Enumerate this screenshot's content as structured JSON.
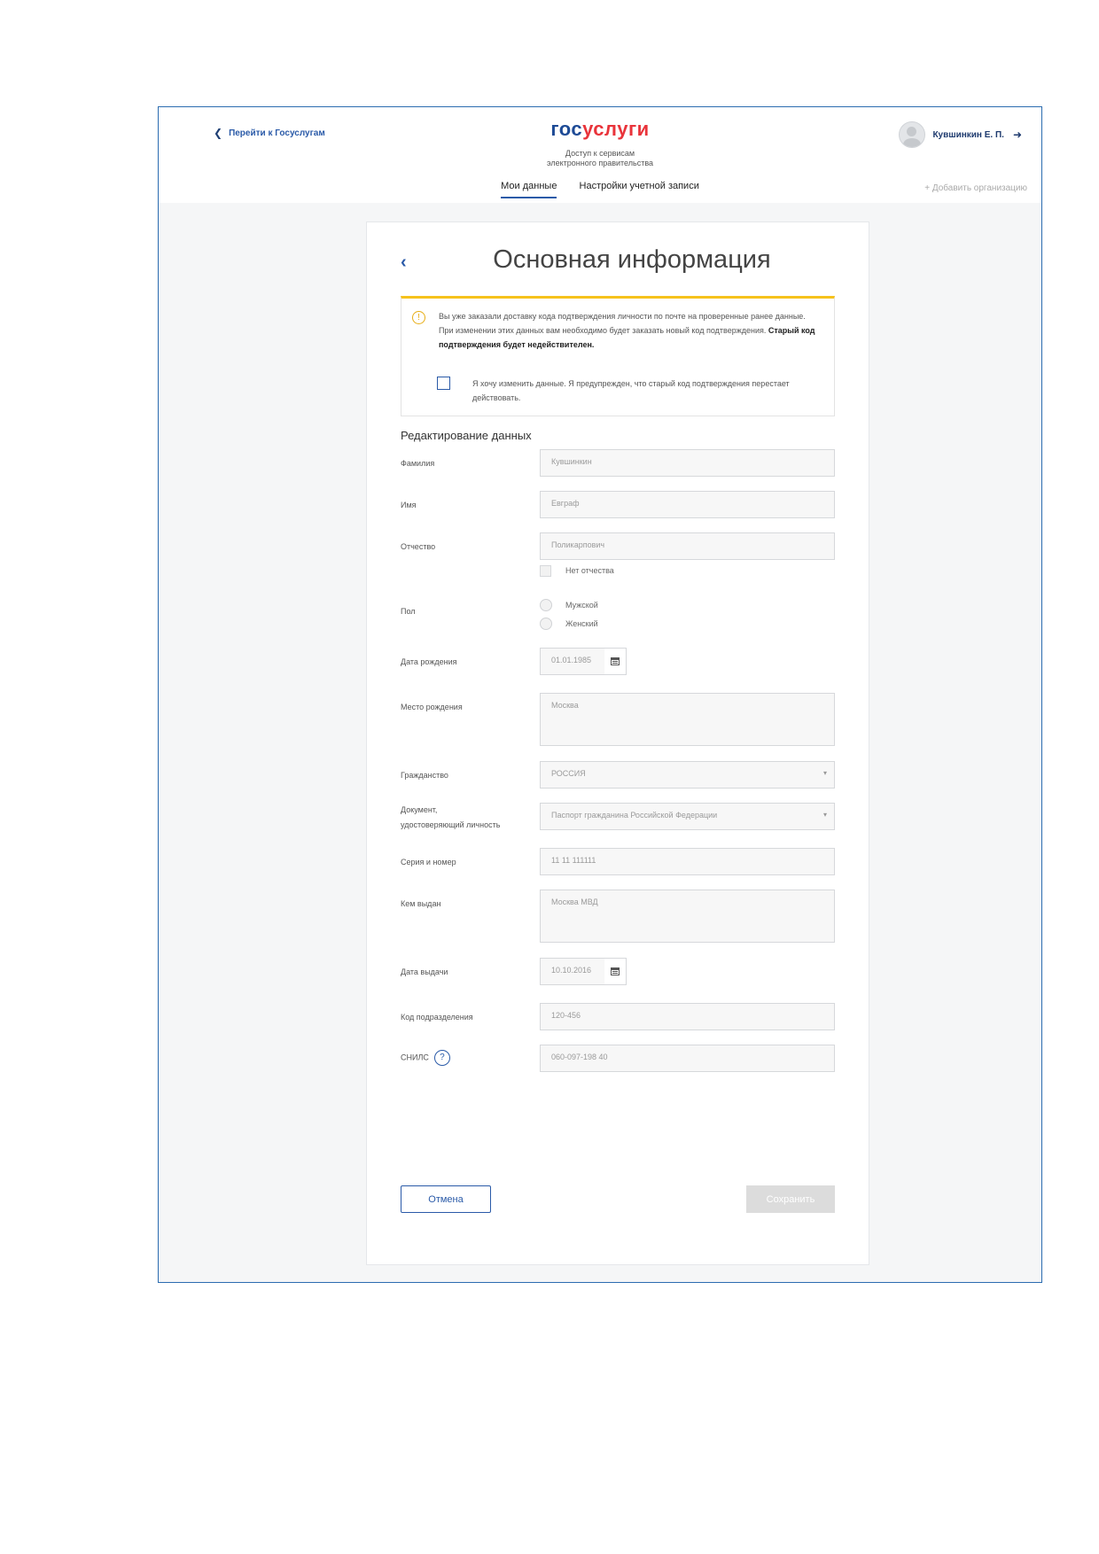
{
  "header": {
    "back_link": "Перейти к Госуслугам",
    "logo_part1": "гос",
    "logo_part2": "услуги",
    "tagline_line1": "Доступ к сервисам",
    "tagline_line2": "электронного правительства",
    "user_name": "Кувшинкин Е. П.",
    "tabs": [
      {
        "label": "Мои данные",
        "active": true
      },
      {
        "label": "Настройки учетной записи",
        "active": false
      }
    ],
    "add_org": "+ Добавить организацию"
  },
  "page": {
    "title": "Основная информация",
    "notice": {
      "text": "Вы уже заказали доставку кода подтверждения личности по почте на проверенные ранее данные. При изменении этих данных вам необходимо будет заказать новый код подтверждения.",
      "bold": "Старый код подтверждения будет недействителен.",
      "agree_label": "Я хочу изменить данные. Я предупрежден, что старый код подтверждения перестает действовать.",
      "agree_checked": false
    },
    "section_title": "Редактирование данных"
  },
  "form": {
    "surname": {
      "label": "Фамилия",
      "value": "Кувшинкин"
    },
    "name": {
      "label": "Имя",
      "value": "Евграф"
    },
    "patronymic": {
      "label": "Отчество",
      "value": "Поликарпович"
    },
    "no_patronymic_label": "Нет отчества",
    "gender": {
      "label": "Пол",
      "options": [
        "Мужской",
        "Женский"
      ]
    },
    "birth_date": {
      "label": "Дата рождения",
      "value": "01.01.1985"
    },
    "birth_place": {
      "label": "Место рождения",
      "value": "Москва"
    },
    "citizenship": {
      "label": "Гражданство",
      "value": "РОССИЯ"
    },
    "document": {
      "label_line1": "Документ,",
      "label_line2": "удостоверяющий личность",
      "value": "Паспорт гражданина Российской Федерации"
    },
    "series_number": {
      "label": "Серия и номер",
      "value": "11 11 111111"
    },
    "issued_by": {
      "label": "Кем выдан",
      "value": "Москва МВД"
    },
    "issue_date": {
      "label": "Дата выдачи",
      "value": "10.10.2016"
    },
    "division_code": {
      "label": "Код подразделения",
      "value": "120-456"
    },
    "snils": {
      "label": "СНИЛС",
      "help": "?",
      "value": "060-097-198 40"
    }
  },
  "buttons": {
    "cancel": "Отмена",
    "save": "Сохранить"
  },
  "colors": {
    "accent": "#2a5aa8",
    "logo_red": "#e9343b",
    "warning": "#f6c21c"
  }
}
